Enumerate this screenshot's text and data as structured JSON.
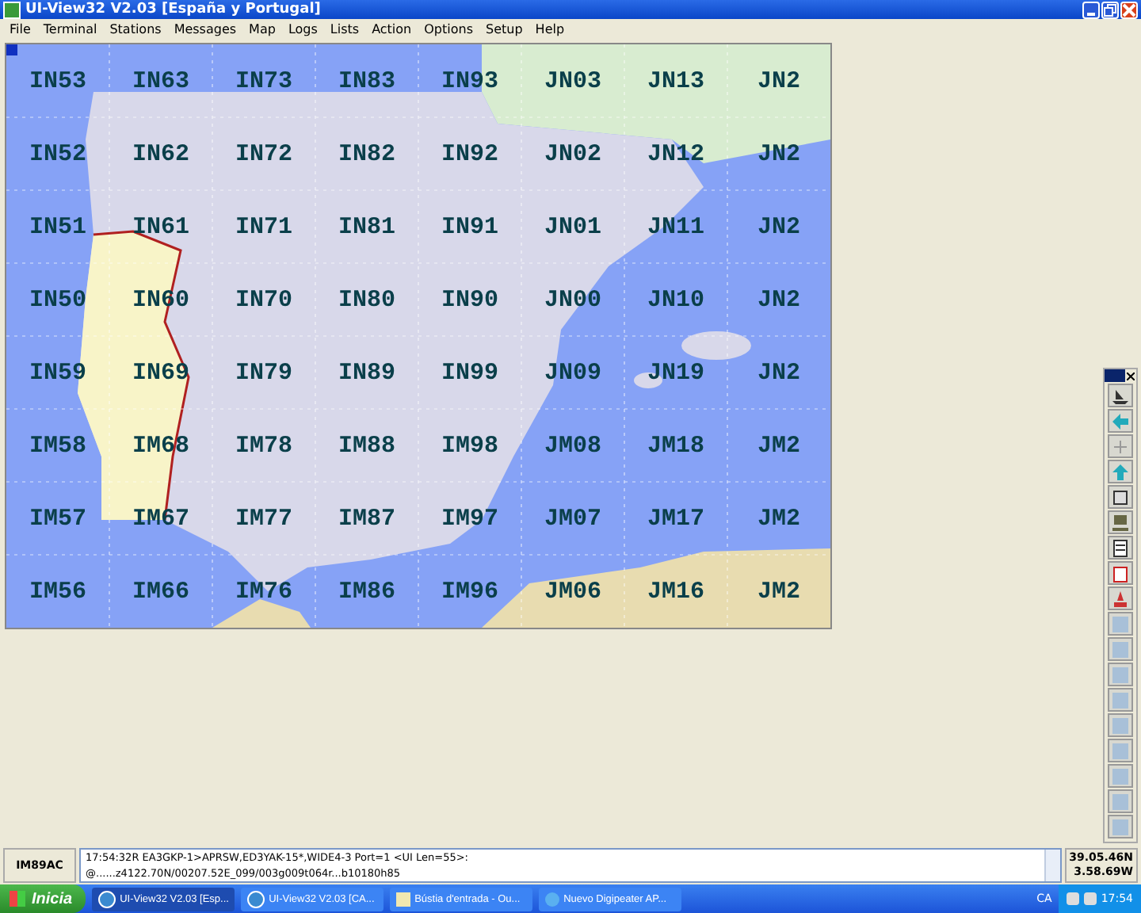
{
  "window": {
    "title": "UI-View32 V2.03 [España y Portugal]"
  },
  "menu": [
    "File",
    "Terminal",
    "Stations",
    "Messages",
    "Map",
    "Logs",
    "Lists",
    "Action",
    "Options",
    "Setup",
    "Help"
  ],
  "map": {
    "grid_labels": [
      [
        "IN53",
        "IN63",
        "IN73",
        "IN83",
        "IN93",
        "JN03",
        "JN13",
        "JN2"
      ],
      [
        "IN52",
        "IN62",
        "IN72",
        "IN82",
        "IN92",
        "JN02",
        "JN12",
        "JN2"
      ],
      [
        "IN51",
        "IN61",
        "IN71",
        "IN81",
        "IN91",
        "JN01",
        "JN11",
        "JN2"
      ],
      [
        "IN50",
        "IN60",
        "IN70",
        "IN80",
        "IN90",
        "JN00",
        "JN10",
        "JN2"
      ],
      [
        "IN59",
        "IN69",
        "IN79",
        "IN89",
        "IN99",
        "JN09",
        "JN19",
        "JN2"
      ],
      [
        "IM58",
        "IM68",
        "IM78",
        "IM88",
        "IM98",
        "JM08",
        "JM18",
        "JM2"
      ],
      [
        "IM57",
        "IM67",
        "IM77",
        "IM87",
        "IM97",
        "JM07",
        "JM17",
        "JM2"
      ],
      [
        "IM56",
        "IM66",
        "IM76",
        "IM86",
        "IM96",
        "JM06",
        "JM16",
        "JM2"
      ]
    ]
  },
  "status_bar": {
    "locator": "IM89AC",
    "message_lines": [
      "17:54:32R EA3GKP-1>APRSW,ED3YAK-15*,WIDE4-3 Port=1 <UI Len=55>:",
      "@......z4122.70N/00207.52E_099/003g009t064r...b10180h85"
    ],
    "latitude": "39.05.46N",
    "longitude": "3.58.69W"
  },
  "taskbar": {
    "start": "Inicia",
    "tasks": [
      {
        "label": "UI-View32 V2.03 [Esp...",
        "selected": true,
        "kind": "globe"
      },
      {
        "label": "UI-View32 V2.03 [CA...",
        "selected": false,
        "kind": "globe"
      },
      {
        "label": "Bústia d'entrada - Ou...",
        "selected": false,
        "kind": "mail"
      },
      {
        "label": "Nuevo Digipeater AP...",
        "selected": false,
        "kind": "browser"
      }
    ],
    "language": "CA",
    "time": "17:54"
  }
}
